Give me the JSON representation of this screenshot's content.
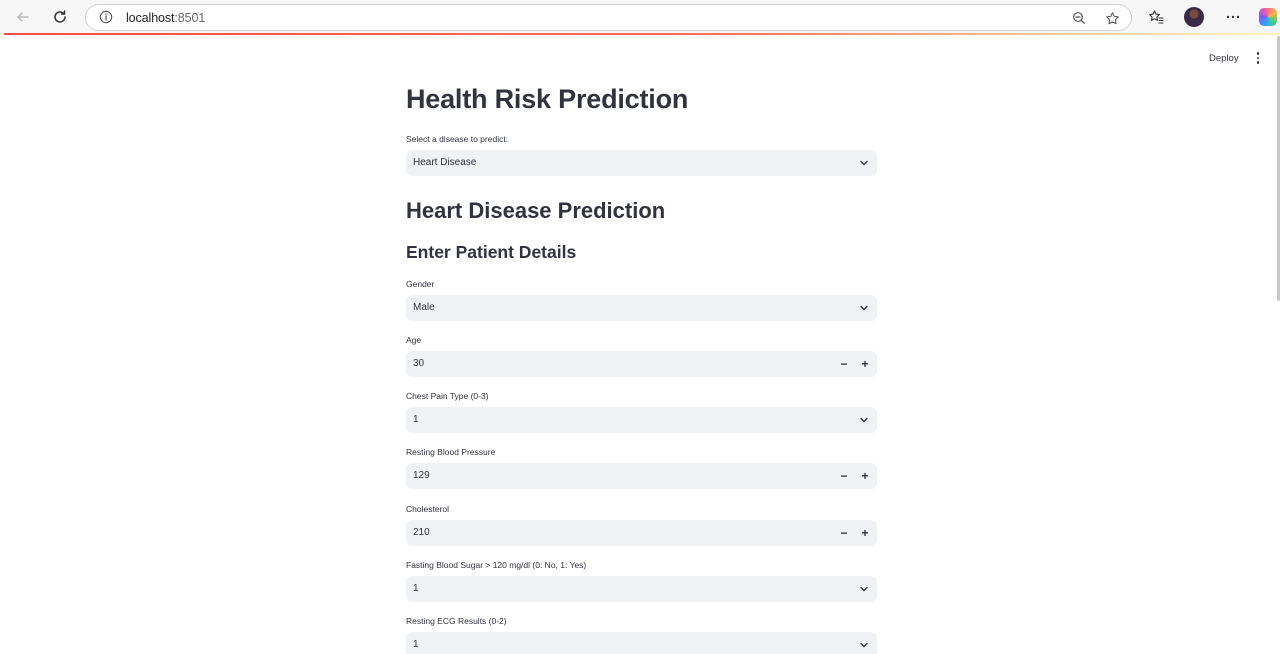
{
  "browser": {
    "url_host": "localhost",
    "url_port": ":8501"
  },
  "app": {
    "deploy_label": "Deploy",
    "title": "Health Risk Prediction",
    "disease_select": {
      "label": "Select a disease to predict:",
      "value": "Heart Disease"
    },
    "section_title": "Heart Disease Prediction",
    "subsection_title": "Enter Patient Details",
    "fields": {
      "gender": {
        "label": "Gender",
        "value": "Male"
      },
      "age": {
        "label": "Age",
        "value": "30"
      },
      "chest_pain": {
        "label": "Chest Pain Type (0-3)",
        "value": "1"
      },
      "resting_bp": {
        "label": "Resting Blood Pressure",
        "value": "129"
      },
      "cholesterol": {
        "label": "Cholesterol",
        "value": "210"
      },
      "fasting_bs": {
        "label": "Fasting Blood Sugar > 120 mg/dl (0: No, 1: Yes)",
        "value": "1"
      },
      "resting_ecg": {
        "label": "Resting ECG Results (0-2)",
        "value": "1"
      }
    },
    "stepper_minus": "−",
    "stepper_plus": "+"
  },
  "colors": {
    "accent": "#ff4b4b",
    "input_bg": "#f0f2f6",
    "text": "#31333f"
  }
}
